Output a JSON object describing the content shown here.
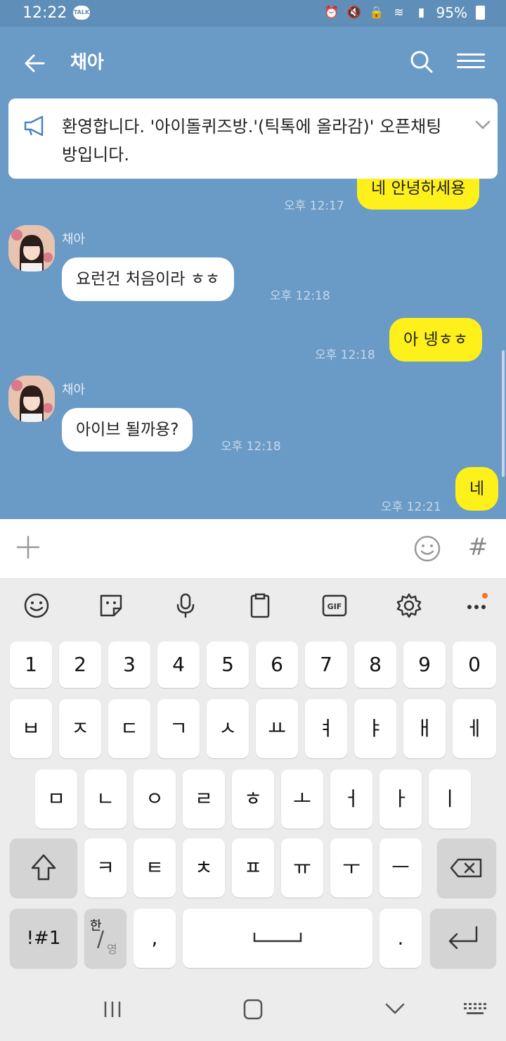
{
  "status_bar": {
    "time": "12:22",
    "talk_badge": "TALK",
    "battery": "95%"
  },
  "header": {
    "title": "채아"
  },
  "notice": {
    "text": "환영합니다. '아이돌퀴즈방.'(틱톡에 올라감)' 오픈채팅방입니다."
  },
  "messages": [
    {
      "from": "me",
      "text": "네 안녕하세용",
      "time": "오후 12:17"
    },
    {
      "from": "other",
      "sender": "채아",
      "text": "요런건 처음이라 ㅎㅎ",
      "time": "오후 12:18"
    },
    {
      "from": "me",
      "text": "아 넹ㅎㅎ",
      "time": "오후 12:18"
    },
    {
      "from": "other",
      "sender": "채아",
      "text": "아이브 될까용?",
      "time": "오후 12:18"
    },
    {
      "from": "me",
      "text": "네",
      "time": "오후 12:21"
    }
  ],
  "input": {
    "placeholder": "",
    "hash_label": "#"
  },
  "keyboard": {
    "row1": [
      "1",
      "2",
      "3",
      "4",
      "5",
      "6",
      "7",
      "8",
      "9",
      "0"
    ],
    "row2": [
      "ㅂ",
      "ㅈ",
      "ㄷ",
      "ㄱ",
      "ㅅ",
      "ㅛ",
      "ㅕ",
      "ㅑ",
      "ㅐ",
      "ㅔ"
    ],
    "row3": [
      "ㅁ",
      "ㄴ",
      "ㅇ",
      "ㄹ",
      "ㅎ",
      "ㅗ",
      "ㅓ",
      "ㅏ",
      "ㅣ"
    ],
    "row4": [
      "ㅋ",
      "ㅌ",
      "ㅊ",
      "ㅍ",
      "ㅠ",
      "ㅜ",
      "ㅡ"
    ],
    "symbols_label": "!#1",
    "lang_top": "한",
    "lang_bottom": "영",
    "comma_label": ",",
    "period_label": "."
  },
  "colors": {
    "chat_bg": "#6a9ac6",
    "my_bubble": "#fef01b",
    "other_bubble": "#ffffff",
    "status_bar": "#5f8fb8",
    "keyboard_bg": "#ececec"
  },
  "icons": [
    "back-arrow-icon",
    "search-icon",
    "menu-icon",
    "megaphone-icon",
    "chevron-down-icon",
    "plus-icon",
    "emoji-icon",
    "hash-icon",
    "emoticon-icon",
    "sticker-icon",
    "microphone-icon",
    "clipboard-icon",
    "gif-icon",
    "settings-icon",
    "more-icon",
    "shift-icon",
    "backspace-icon",
    "space-icon",
    "enter-icon",
    "recent-apps-icon",
    "home-icon",
    "back-nav-icon",
    "keyboard-icon"
  ]
}
